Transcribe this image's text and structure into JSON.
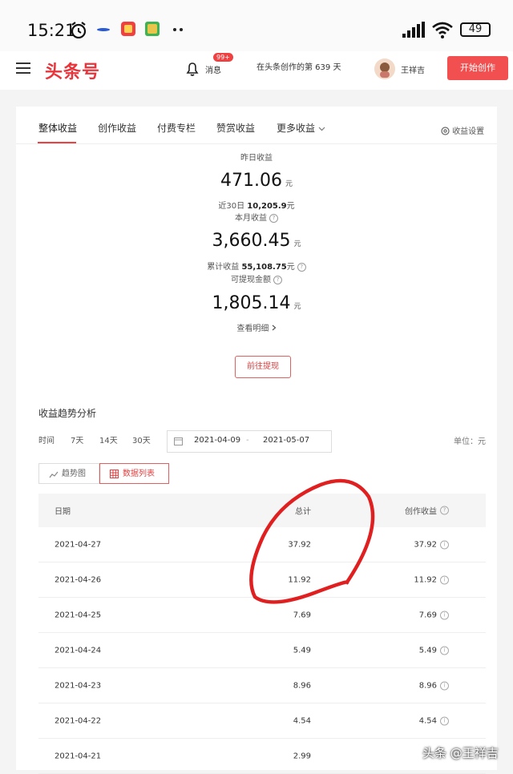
{
  "status_bar": {
    "time": "15:21",
    "battery": "49",
    "icons": [
      "alarm-icon",
      "app-icon-1",
      "app-icon-2",
      "app-icon-3",
      "signal-icon",
      "wifi-icon",
      "battery-icon"
    ]
  },
  "header": {
    "logo": "头条号",
    "messages_label": "消息",
    "messages_badge": "99+",
    "days_text": "在头条创作的第 639 天",
    "username": "王祥吉",
    "start_button": "开始创作"
  },
  "tabs": [
    {
      "label": "整体收益",
      "active": true
    },
    {
      "label": "创作收益",
      "active": false
    },
    {
      "label": "付费专栏",
      "active": false
    },
    {
      "label": "赞赏收益",
      "active": false
    },
    {
      "label": "更多收益",
      "active": false
    }
  ],
  "settings_label": "收益设置",
  "summary": {
    "yesterday_label": "昨日收益",
    "yesterday_value": "471.06",
    "unit": "元",
    "last30_label": "近30日",
    "last30_value": "10,205.9",
    "month_label": "本月收益",
    "month_value": "3,660.45",
    "total_label": "累计收益",
    "total_value": "55,108.75",
    "withdrawable_label": "可提现金额",
    "withdrawable_value": "1,805.14",
    "details_link": "查看明细",
    "withdraw_button": "前往提现"
  },
  "trend": {
    "title": "收益趋势分析",
    "time_label": "时间",
    "ranges": [
      "7天",
      "14天",
      "30天"
    ],
    "date_start": "2021-04-09",
    "date_sep": "-",
    "date_end": "2021-05-07",
    "unit_label": "单位：元",
    "view_chart": "趋势图",
    "view_table": "数据列表"
  },
  "table": {
    "headers": [
      "日期",
      "总计",
      "创作收益"
    ],
    "rows": [
      {
        "date": "2021-04-27",
        "total": "37.92",
        "creation": "37.92"
      },
      {
        "date": "2021-04-26",
        "total": "11.92",
        "creation": "11.92"
      },
      {
        "date": "2021-04-25",
        "total": "7.69",
        "creation": "7.69"
      },
      {
        "date": "2021-04-24",
        "total": "5.49",
        "creation": "5.49"
      },
      {
        "date": "2021-04-23",
        "total": "8.96",
        "creation": "8.96"
      },
      {
        "date": "2021-04-22",
        "total": "4.54",
        "creation": "4.54"
      },
      {
        "date": "2021-04-21",
        "total": "2.99",
        "creation": ""
      }
    ]
  },
  "watermark": "头条 @王祥吉",
  "colors": {
    "brand": "#e8353b",
    "accent_button": "#f25050",
    "annotation": "#e02020"
  }
}
